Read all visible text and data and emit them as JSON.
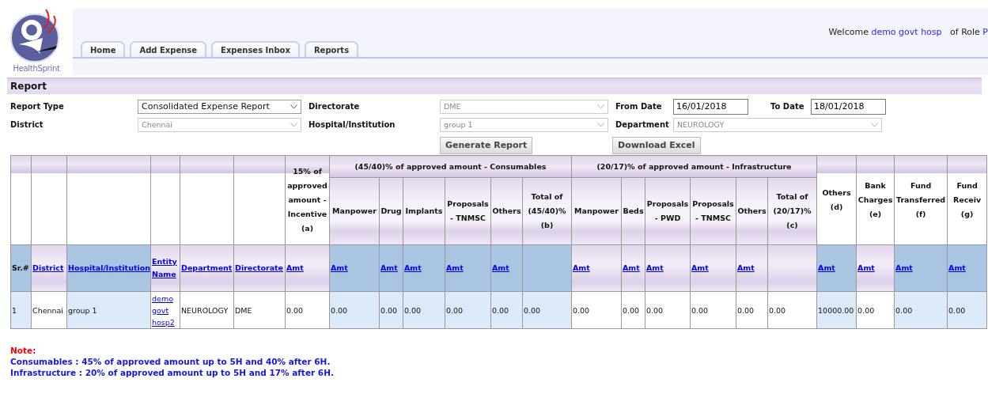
{
  "logo": {
    "text": "HealthSprint"
  },
  "nav_tabs": [
    {
      "label": "Home",
      "selected": false
    },
    {
      "label": "Add Expense",
      "selected": false
    },
    {
      "label": "Expenses Inbox",
      "selected": false
    },
    {
      "label": "Reports",
      "selected": false
    }
  ],
  "welcome": {
    "prefix": "Welcome",
    "user": "demo govt hosp",
    "role_label": "of Role",
    "role": "P"
  },
  "section_title": "Report",
  "filters": [
    {
      "label": "Report Type",
      "kind": "select",
      "value": "Consolidated Expense Report",
      "disabled": false
    },
    {
      "label": "Directorate",
      "kind": "select",
      "value": "DME",
      "disabled": true
    },
    {
      "label": "From Date",
      "kind": "date",
      "value": "16/01/2018"
    },
    {
      "label": "To Date",
      "kind": "date",
      "value": "18/01/2018"
    },
    {
      "label": "District",
      "kind": "select",
      "value": "Chennai",
      "disabled": true
    },
    {
      "label": "Hospital/Institution",
      "kind": "select",
      "value": "group 1",
      "disabled": true
    },
    {
      "label": "Department",
      "kind": "select",
      "value": "NEUROLOGY",
      "disabled": true
    }
  ],
  "buttons": [
    "Generate Report",
    "Download Excel"
  ],
  "table": {
    "header": [
      {
        "kind": "single",
        "sort": "Sr.#",
        "sort_link": false
      },
      {
        "kind": "single",
        "sort": "District",
        "sort_link": true
      },
      {
        "kind": "single",
        "sort": "Hospital/Institution",
        "sort_link": true
      },
      {
        "kind": "single",
        "sort": "Entity Name",
        "sort_link": true,
        "cell_link": true
      },
      {
        "kind": "single",
        "sort": "Department",
        "sort_link": true
      },
      {
        "kind": "single",
        "sort": "Directorate",
        "sort_link": true
      },
      {
        "kind": "single",
        "label": "15% of approved amount - Incentive (a)",
        "sort": "Amt",
        "sort_link": true
      },
      {
        "kind": "group",
        "title": "(45/40)% of approved amount - Consumables",
        "columns": [
          {
            "label": "Manpower",
            "sort": "Amt",
            "sort_link": true
          },
          {
            "label": "Drug",
            "sort": "Amt",
            "sort_link": true
          },
          {
            "label": "Implants",
            "sort": "Amt",
            "sort_link": true
          },
          {
            "label": "Proposals - TNMSC",
            "sort": "Amt",
            "sort_link": true
          },
          {
            "label": "Others",
            "sort": "Amt",
            "sort_link": true
          },
          {
            "label": "Total of (45/40)% (b)"
          }
        ]
      },
      {
        "kind": "group",
        "title": "(20/17)% of approved amount - Infrastructure",
        "columns": [
          {
            "label": "Manpower",
            "sort": "Amt",
            "sort_link": true
          },
          {
            "label": "Beds",
            "sort": "Amt",
            "sort_link": true
          },
          {
            "label": "Proposals - PWD",
            "sort": "Amt",
            "sort_link": true
          },
          {
            "label": "Proposals - TNMSC",
            "sort": "Amt",
            "sort_link": true
          },
          {
            "label": "Others",
            "sort": "Amt",
            "sort_link": true
          },
          {
            "label": "Total of (20/17)% (c)"
          }
        ]
      },
      {
        "kind": "single",
        "label": "Others (d)",
        "sort": "Amt",
        "sort_link": true
      },
      {
        "kind": "single",
        "label": "Bank Charges (e)",
        "sort": "Amt",
        "sort_link": true
      },
      {
        "kind": "single",
        "label": "Fund Transferred (f)",
        "sort": "Amt",
        "sort_link": true
      },
      {
        "kind": "single",
        "label": "Fund Receiv (g)",
        "sort": "Amt",
        "sort_link": true
      }
    ],
    "rows": [
      [
        "1",
        "Chennai",
        "group 1",
        "demo govt hosp2",
        "NEUROLOGY",
        "DME",
        "0.00",
        "0.00",
        "0.00",
        "0.00",
        "0.00",
        "0.00",
        "0.00",
        "0.00",
        "0.00",
        "0.00",
        "0.00",
        "0.00",
        "0.00",
        "10000.00",
        "0.00",
        "0.00",
        "0.00"
      ]
    ]
  },
  "note": {
    "title": "Note:",
    "lines": [
      "Consumables : 45% of approved amount up to 5H and 40% after 6H.",
      "Infrastructure : 20% of approved amount up to 5H and 17% after 6H."
    ]
  }
}
